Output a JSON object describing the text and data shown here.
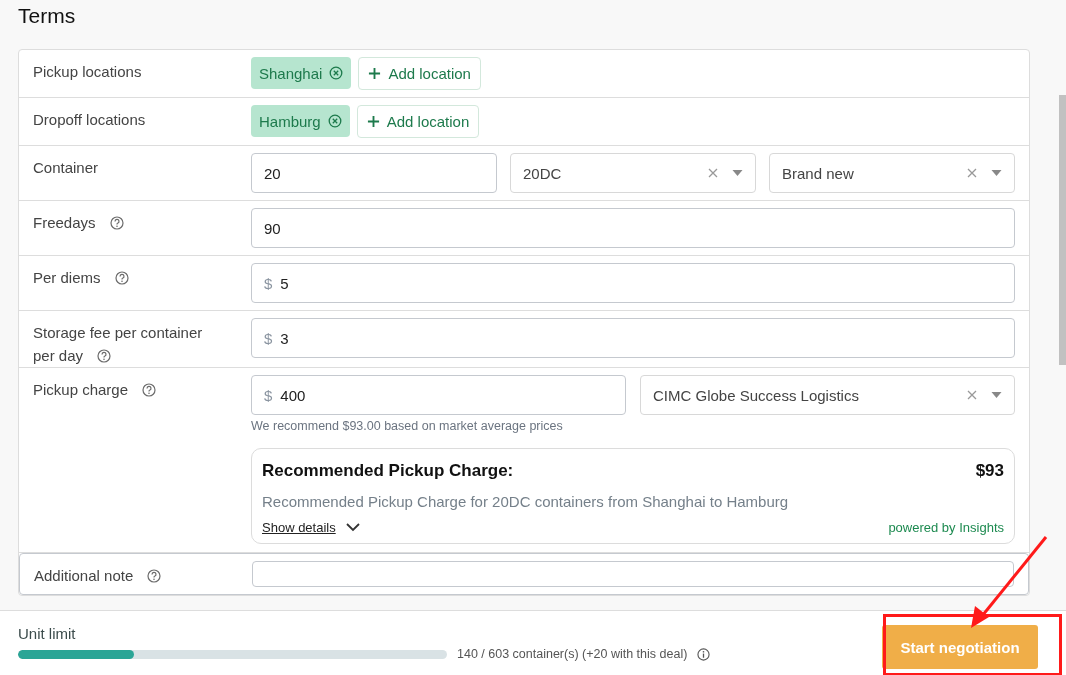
{
  "title": "Terms",
  "rows": [
    {
      "kind": "tags",
      "label": "Pickup locations",
      "tags": [
        "Shanghai"
      ],
      "add_button": "Add location"
    },
    {
      "kind": "tags",
      "label": "Dropoff locations",
      "tags": [
        "Hamburg"
      ],
      "add_button": "Add location"
    },
    {
      "kind": "container",
      "label": "Container",
      "value": "20",
      "selects": [
        "20DC",
        "Brand new"
      ]
    },
    {
      "kind": "input",
      "label": "Freedays",
      "help": true,
      "value": "90"
    },
    {
      "kind": "money",
      "label": "Per diems",
      "help": true,
      "prefix": "$",
      "value": "5"
    },
    {
      "kind": "money",
      "label": "Storage fee per container per day",
      "help": true,
      "prefix": "$",
      "value": "3"
    },
    {
      "kind": "pickup",
      "label": "Pickup charge",
      "help": true,
      "prefix": "$",
      "value": "400",
      "select": "CIMC Globe Success Logistics",
      "hint": "We recommend $93.00 based on market average prices",
      "card": {
        "title": "Recommended Pickup Charge:",
        "amount": "$93",
        "description": "Recommended Pickup Charge for 20DC containers from Shanghai to Hamburg",
        "details_link": "Show details",
        "credit": "powered by Insights"
      }
    },
    {
      "kind": "note",
      "label": "Additional note",
      "help": true
    }
  ],
  "footer": {
    "label": "Unit limit",
    "level": 0.27,
    "reading": "140 / 603 container(s) (+20 with this deal)",
    "button": "Start negotiation"
  }
}
